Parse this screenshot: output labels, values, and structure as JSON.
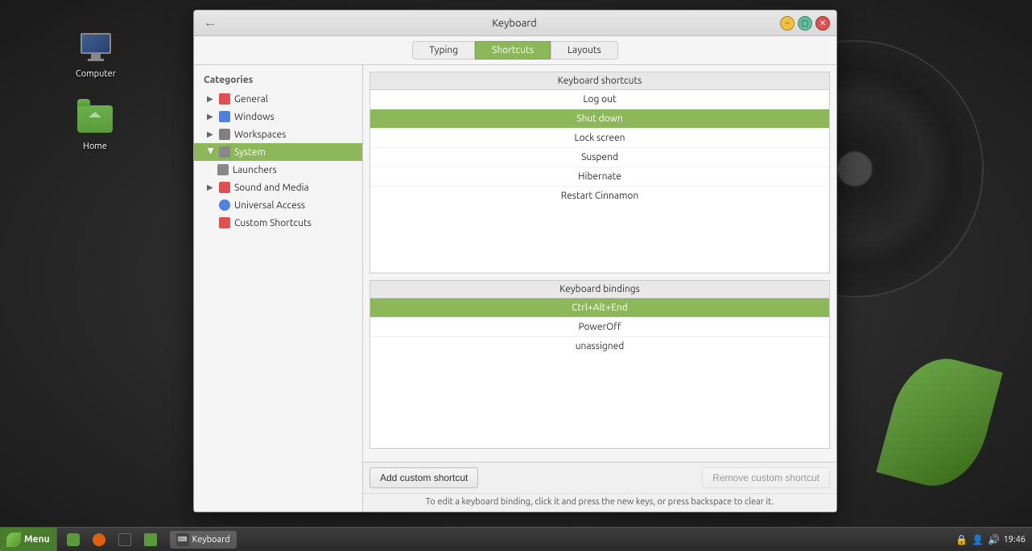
{
  "desktop": {
    "icons": [
      {
        "id": "computer",
        "label": "Computer",
        "type": "monitor"
      },
      {
        "id": "home",
        "label": "Home",
        "type": "folder"
      }
    ]
  },
  "window": {
    "title": "Keyboard",
    "tabs": [
      {
        "id": "typing",
        "label": "Typing",
        "active": false
      },
      {
        "id": "shortcuts",
        "label": "Shortcuts",
        "active": true
      },
      {
        "id": "layouts",
        "label": "Layouts",
        "active": false
      }
    ],
    "sidebar": {
      "header": "Categories",
      "items": [
        {
          "id": "general",
          "label": "General",
          "hasChildren": true,
          "icon": "🔴",
          "iconClass": "icon-general"
        },
        {
          "id": "windows",
          "label": "Windows",
          "hasChildren": true,
          "icon": "🔷",
          "iconClass": "icon-windows"
        },
        {
          "id": "workspaces",
          "label": "Workspaces",
          "hasChildren": true,
          "icon": "⬜",
          "iconClass": "icon-workspaces"
        },
        {
          "id": "system",
          "label": "System",
          "hasChildren": false,
          "icon": "⬜",
          "iconClass": "icon-system",
          "selected": true
        },
        {
          "id": "launchers",
          "label": "Launchers",
          "hasChildren": false,
          "icon": "⬜",
          "iconClass": "icon-launchers",
          "sub": true
        },
        {
          "id": "sound-media",
          "label": "Sound and Media",
          "hasChildren": true,
          "icon": "🔴",
          "iconClass": "icon-media"
        },
        {
          "id": "universal-access",
          "label": "Universal Access",
          "hasChildren": false,
          "icon": "🔷",
          "iconClass": "icon-access"
        },
        {
          "id": "custom-shortcuts",
          "label": "Custom Shortcuts",
          "hasChildren": false,
          "icon": "🔴",
          "iconClass": "icon-shortcuts"
        }
      ]
    },
    "shortcuts_table": {
      "header": "Keyboard shortcuts",
      "rows": [
        {
          "id": "logout",
          "label": "Log out",
          "selected": false
        },
        {
          "id": "shutdown",
          "label": "Shut down",
          "selected": true
        },
        {
          "id": "lockscreen",
          "label": "Lock screen",
          "selected": false
        },
        {
          "id": "suspend",
          "label": "Suspend",
          "selected": false
        },
        {
          "id": "hibernate",
          "label": "Hibernate",
          "selected": false
        },
        {
          "id": "restart-cinnamon",
          "label": "Restart Cinnamon",
          "selected": false
        }
      ]
    },
    "bindings_table": {
      "header": "Keyboard bindings",
      "rows": [
        {
          "id": "binding1",
          "label": "Ctrl+Alt+End",
          "selected": true
        },
        {
          "id": "binding2",
          "label": "PowerOff",
          "selected": false
        },
        {
          "id": "binding3",
          "label": "unassigned",
          "selected": false
        }
      ]
    },
    "buttons": {
      "add": "Add custom shortcut",
      "remove": "Remove custom shortcut"
    },
    "help_text": "To edit a keyboard binding, click it and press the new keys, or press backspace to clear it."
  },
  "taskbar": {
    "menu_label": "Menu",
    "time": "19:46",
    "keyboard_label": "Keyboard",
    "active_window_label": "Keyboard"
  }
}
